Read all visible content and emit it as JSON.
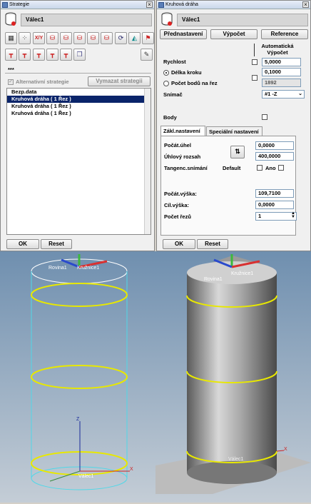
{
  "left_window": {
    "title": "Strategie",
    "header_name": "Válec1",
    "toolbar_row1_icons": [
      "grid-icon",
      "dots-grid-icon",
      "xy-arrows-icon",
      "cylinder-red-icon-1",
      "cylinder-red-icon-2",
      "cylinder-red-icon-3",
      "cylinder-red-icon-4",
      "cylinder-red-icon-5",
      "rotate-icon",
      "surface-icon",
      "flag-icon"
    ],
    "toolbar_row2_icons": [
      "probe-icon-1",
      "probe-icon-2",
      "probe-icon-3",
      "probe-icon-4",
      "probe-icon-5",
      "cube-icon"
    ],
    "stars": "***",
    "alt_strategy_label": "Alternativní strategie",
    "delete_strategy_label": "Vymazat strategii",
    "list_items": [
      {
        "label": "Bezp.data",
        "selected": false
      },
      {
        "label": "Kruhová dráha  ( 1 Řez )",
        "selected": true
      },
      {
        "label": "Kruhová dráha  ( 1 Řez )",
        "selected": false
      },
      {
        "label": "Kruhová dráha  ( 1 Řez )",
        "selected": false
      }
    ],
    "ok_label": "OK",
    "reset_label": "Reset"
  },
  "right_window": {
    "title": "Kruhová dráha",
    "header_name": "Válec1",
    "btn_presets": "Přednastavení",
    "btn_calc": "Výpočet",
    "btn_reference": "Reference",
    "auto_speed_label": "Automatická Výpočet",
    "speed_label": "Rychlost",
    "speed_value": "5,0000",
    "step_length_label": "Délka kroku",
    "step_length_value": "0,1000",
    "points_count_label": "Počet bodů na řez",
    "points_count_value": "1892",
    "probe_label": "Snímač",
    "probe_value": "#1    -Z",
    "points_label": "Body",
    "tabs": [
      "Zákl.nastavení",
      "Speciální nastavení"
    ],
    "start_angle_label": "Počát.úhel",
    "start_angle_value": "0,0000",
    "angle_range_label": "Úhlový rozsah",
    "angle_range_value": "400,0000",
    "tangent_label": "Tangenc.snímání",
    "default_label": "Default",
    "yes_label": "Ano",
    "start_height_label": "Počát.výška:",
    "start_height_value": "109,7100",
    "end_height_label": "Cíl.výška:",
    "end_height_value": "0,0000",
    "cuts_label": "Počet řezů",
    "cuts_value": "1",
    "ok_label": "OK",
    "reset_label": "Reset"
  },
  "viewport_left": {
    "label_plane": "Rovina1",
    "label_circle": "Kružnice1",
    "label_cylinder": "Válec1",
    "axis_x": "X",
    "axis_z": "Z"
  },
  "viewport_right": {
    "label_plane": "Rovina1",
    "label_circle": "Kružnice1",
    "label_cylinder": "Válec1",
    "axis_x": "X"
  },
  "colors": {
    "selection": "#0a246a",
    "path_yellow": "#e8e800",
    "wire_cyan": "#4fd8e8",
    "viewport_top": "#6f8faf",
    "viewport_bottom": "#c4cdd6"
  }
}
